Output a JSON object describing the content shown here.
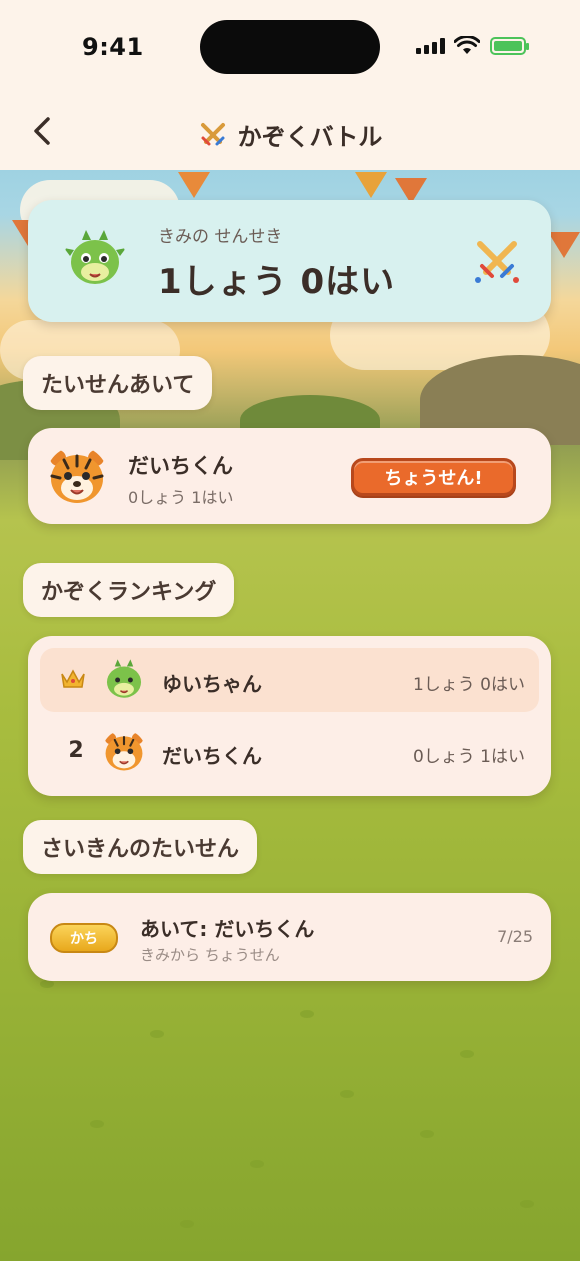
{
  "status_bar": {
    "time": "9:41"
  },
  "nav": {
    "title": "かぞくバトル"
  },
  "record": {
    "label": "きみの せんせき",
    "value": "1しょう 0はい"
  },
  "sections": {
    "opponent": "たいせんあいて",
    "ranking": "かぞくランキング",
    "recent": "さいきんのたいせん"
  },
  "opponent": {
    "name": "だいちくん",
    "record": "0しょう 1はい",
    "challenge_label": "ちょうせん!"
  },
  "ranking": [
    {
      "rank": "crown-icon",
      "name": "ゆいちゃん",
      "record": "1しょう 0はい"
    },
    {
      "rank": "2",
      "name": "だいちくん",
      "record": "0しょう 1はい"
    }
  ],
  "recent": [
    {
      "badge": "かち",
      "title": "あいて: だいちくん",
      "subtitle": "きみから ちょうせん",
      "date": "7/25"
    }
  ],
  "colors": {
    "accent": "#ea6a2b",
    "record_card": "#d8f1ef",
    "card": "#fdeee7",
    "nav_bg": "#fdf3ea"
  }
}
